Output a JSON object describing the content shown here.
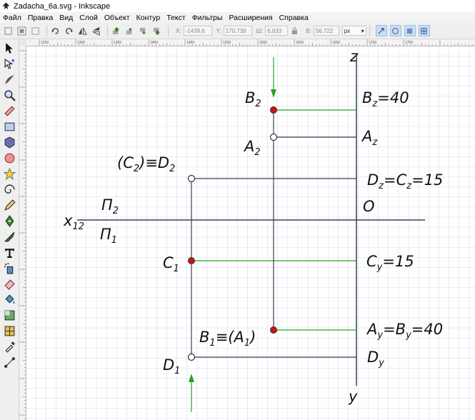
{
  "window": {
    "title": "Zadacha_6a.svg - Inkscape"
  },
  "menu": [
    "Файл",
    "Правка",
    "Вид",
    "Слой",
    "Объект",
    "Контур",
    "Текст",
    "Фильтры",
    "Расширения",
    "Справка"
  ],
  "toolbar": {
    "x_label": "X:",
    "x_value": "-1439,6",
    "y_label": "Y:",
    "y_value": "170,739",
    "w_label": "Ш:",
    "w_value": "6,633",
    "h_label": "В:",
    "h_value": "56,722",
    "unit": "px"
  },
  "ruler": {
    "top_labels": [
      "1250",
      "1300",
      "1350",
      "1400",
      "1450",
      "1500",
      "1550",
      "1600",
      "1650",
      "1700",
      "1750"
    ]
  },
  "tools": [
    "selector-tool",
    "node-tool",
    "tweak-tool",
    "zoom-tool",
    "measure-tool",
    "rectangle-tool",
    "3d-box-tool",
    "ellipse-tool",
    "star-tool",
    "spiral-tool",
    "pencil-tool",
    "pen-tool",
    "calligraphy-tool",
    "text-tool",
    "spray-tool",
    "eraser-tool",
    "paint-bucket-tool",
    "gradient-tool",
    "mesh-tool",
    "dropper-tool",
    "connector-tool"
  ],
  "drawing": {
    "colors": {
      "line": "#3a3f52",
      "green": "#2aa02a",
      "red_point": "#cc1111",
      "grid": "#c9cde6"
    },
    "labels": {
      "z": "z",
      "y": "y",
      "x12_main": "x",
      "x12_sub": "12",
      "pi2_main": "Π",
      "pi2_sub": "2",
      "pi1_main": "Π",
      "pi1_sub": "1",
      "O": "O",
      "B2_main": "B",
      "B2_sub": "2",
      "A2_main": "A",
      "A2_sub": "2",
      "C2D2_a": "(C",
      "C2D2_b": "2",
      "C2D2_c": ")≡D",
      "C2D2_d": "2",
      "C1_main": "C",
      "C1_sub": "1",
      "B1A1_a": "B",
      "B1A1_b": "1",
      "B1A1_c": "≡(A",
      "B1A1_d": "1",
      "B1A1_e": ")",
      "D1_main": "D",
      "D1_sub": "1",
      "Bz_main": "B",
      "Bz_sub": "z",
      "Bz_val": "=40",
      "Az_main": "A",
      "Az_sub": "z",
      "DzCz_a": "D",
      "DzCz_b": "z",
      "DzCz_c": "=C",
      "DzCz_d": "z",
      "DzCz_e": "=15",
      "Cy_main": "C",
      "Cy_sub": "y",
      "Cy_val": "=15",
      "AyBy_a": "A",
      "AyBy_b": "y",
      "AyBy_c": "=B",
      "AyBy_d": "y",
      "AyBy_e": "=40",
      "Dy_main": "D",
      "Dy_sub": "y"
    }
  }
}
